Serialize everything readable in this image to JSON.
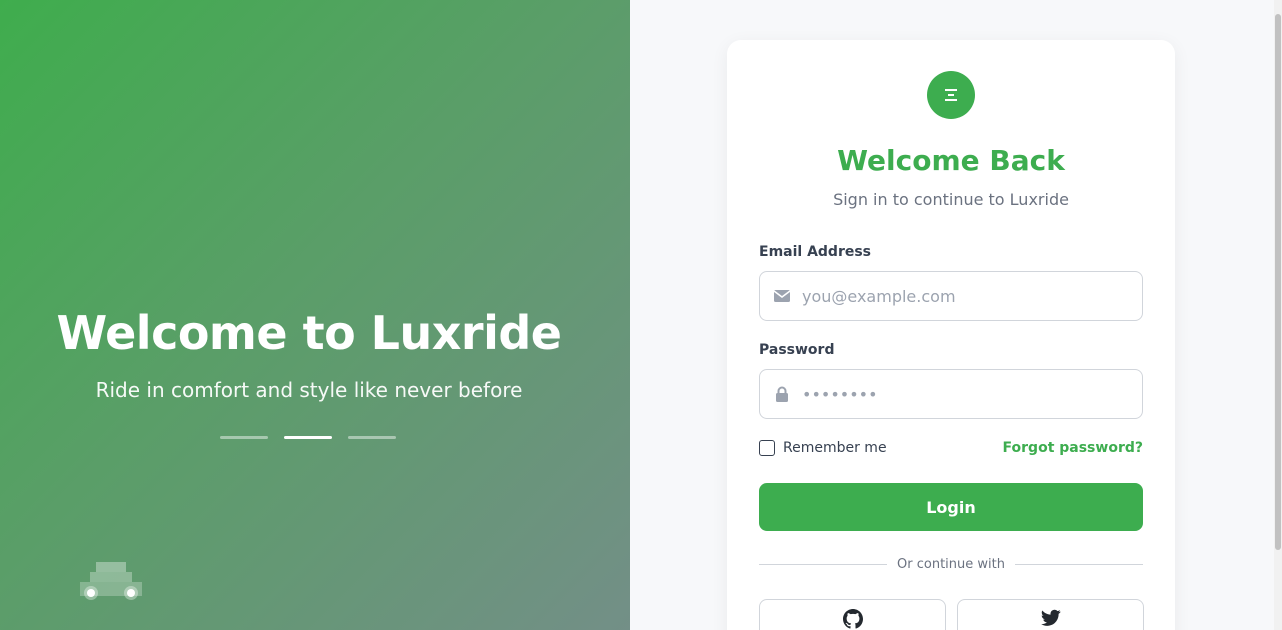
{
  "hero": {
    "title": "Welcome to Luxride",
    "subtitle": "Ride in comfort and style like never before",
    "slides": [
      {
        "active": false
      },
      {
        "active": true
      },
      {
        "active": false
      }
    ],
    "decoration_icon": "car-icon"
  },
  "login": {
    "logo_icon": "menu-icon",
    "title": "Welcome Back",
    "subtitle": "Sign in to continue to Luxride",
    "email": {
      "label": "Email Address",
      "placeholder": "you@example.com",
      "value": "",
      "icon": "envelope-icon"
    },
    "password": {
      "label": "Password",
      "placeholder": "••••••••",
      "value": "",
      "icon": "lock-icon"
    },
    "remember_label": "Remember me",
    "remember_checked": false,
    "forgot_label": "Forgot password?",
    "login_label": "Login",
    "divider_label": "Or continue with",
    "social": [
      {
        "icon": "github-icon"
      },
      {
        "icon": "twitter-icon"
      }
    ]
  },
  "colors": {
    "accent": "#3dad4f",
    "hero_gradient_start": "#3fad4d",
    "hero_gradient_end": "#738f87",
    "page_bg": "#f7f8fa"
  }
}
